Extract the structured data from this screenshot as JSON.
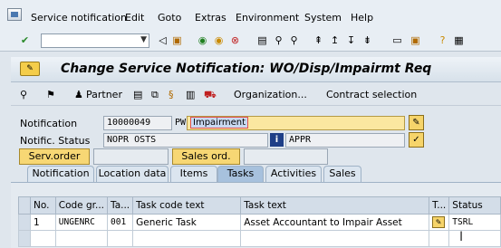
{
  "menu": {
    "items": [
      "Service notification",
      "Edit",
      "Goto",
      "Extras",
      "Environment",
      "System",
      "Help"
    ]
  },
  "toolbar": {
    "command_field_value": "",
    "icons": [
      "enter-icon",
      "back-icon",
      "save-icon",
      "back-green-icon",
      "exit-icon",
      "cancel-icon",
      "print-icon",
      "find-icon",
      "find-next-icon",
      "first-page-icon",
      "prev-page-icon",
      "next-page-icon",
      "last-page-icon",
      "create-session-icon",
      "shortcut-icon",
      "help-icon",
      "customize-icon"
    ]
  },
  "title": "Change Service Notification: WO/Disp/Impairmt Req",
  "app_toolbar": {
    "partner_label": "Partner",
    "organization_label": "Organization...",
    "contract_label": "Contract selection"
  },
  "header": {
    "notification_label": "Notification",
    "notification_value": "10000049",
    "notification_type": "PW",
    "notification_text": "Impairment",
    "status_label": "Notific. Status",
    "status_value": "NOPR OSTS",
    "status_info_label": "i",
    "status_code": "APPR",
    "serv_order_label": "Serv.order",
    "sales_ord_label": "Sales ord."
  },
  "tabs": [
    {
      "label": "Notification",
      "active": false
    },
    {
      "label": "Location data",
      "active": false
    },
    {
      "label": "Items",
      "active": false
    },
    {
      "label": "Tasks",
      "active": true
    },
    {
      "label": "Activities",
      "active": false
    },
    {
      "label": "Sales",
      "active": false
    }
  ],
  "tasks_table": {
    "columns": [
      "No.",
      "Code gr...",
      "Ta...",
      "Task code text",
      "Task text",
      "T...",
      "Status"
    ],
    "rows": [
      {
        "no": "1",
        "code_group": "UNGENRC",
        "task": "001",
        "task_code_text": "Generic Task",
        "task_text": "Asset Accountant to Impair Asset",
        "status": "TSRL"
      }
    ]
  },
  "colors": {
    "title_bg": "#d7e1ea",
    "active_tab": "#a7c1dd",
    "yellow_button": "#f7d774",
    "highlight_field": "#fbe7a0"
  }
}
